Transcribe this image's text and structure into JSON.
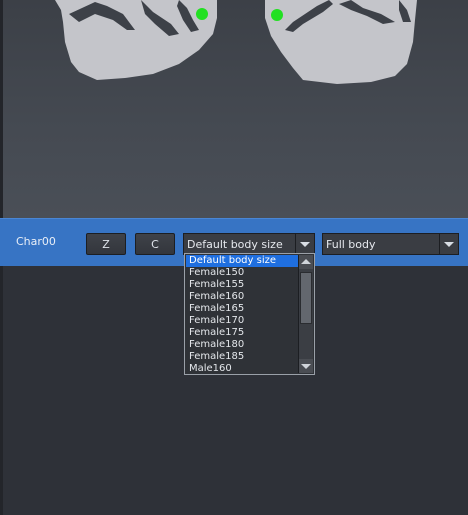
{
  "toolbar": {
    "char_label": "Char00",
    "z_button": "Z",
    "c_button": "C",
    "body_size_select": "Default body size",
    "view_select": "Full body"
  },
  "dropdown": {
    "options": [
      "Default body size",
      "Female150",
      "Female155",
      "Female160",
      "Female165",
      "Female170",
      "Female175",
      "Female180",
      "Female185",
      "Male160"
    ],
    "selected_index": 0
  },
  "colors": {
    "toolbar": "#3774c4",
    "selected_option": "#1f6fe0",
    "marker": "#22e022"
  }
}
